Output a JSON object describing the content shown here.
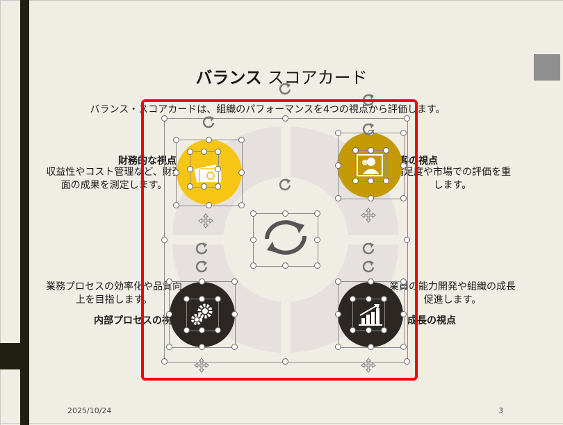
{
  "slide": {
    "title_bold": "バランス",
    "title_rest": "スコアカード",
    "subtitle": "バランス・スコアカードは、組織のパフォーマンスを4つの視点から評価します。"
  },
  "perspectives": {
    "financial": {
      "heading": "財務的な視点",
      "text_line1": "収益性やコスト管理など、財務",
      "text_line2": "面の成果を測定します。",
      "icon": "money-icon",
      "color": "#f7c614"
    },
    "customer": {
      "heading": "顧客の視点",
      "text_line1": "満足度や市場での評価を重",
      "text_line2": "します。",
      "icon": "people-icon",
      "color": "#c39a05"
    },
    "internal": {
      "heading": "内部プロセスの視点",
      "text_line1": "業務プロセスの効率化や品質向",
      "text_line2": "上を目指します。",
      "icon": "gears-icon",
      "color": "#2d2724"
    },
    "learning": {
      "heading": "成長の視点",
      "text_line1": "業員の能力開発や組織の成長",
      "text_line2": "促進します。",
      "icon": "growth-chart-icon",
      "color": "#2d2724"
    }
  },
  "center_icon": "cycle-arrows-icon",
  "footer": {
    "date": "2025/10/24",
    "page": "3"
  },
  "colors": {
    "background": "#f0ede5",
    "side_bar": "#1f2012",
    "highlight_box": "#f00000",
    "ring": "#e6e0de"
  }
}
